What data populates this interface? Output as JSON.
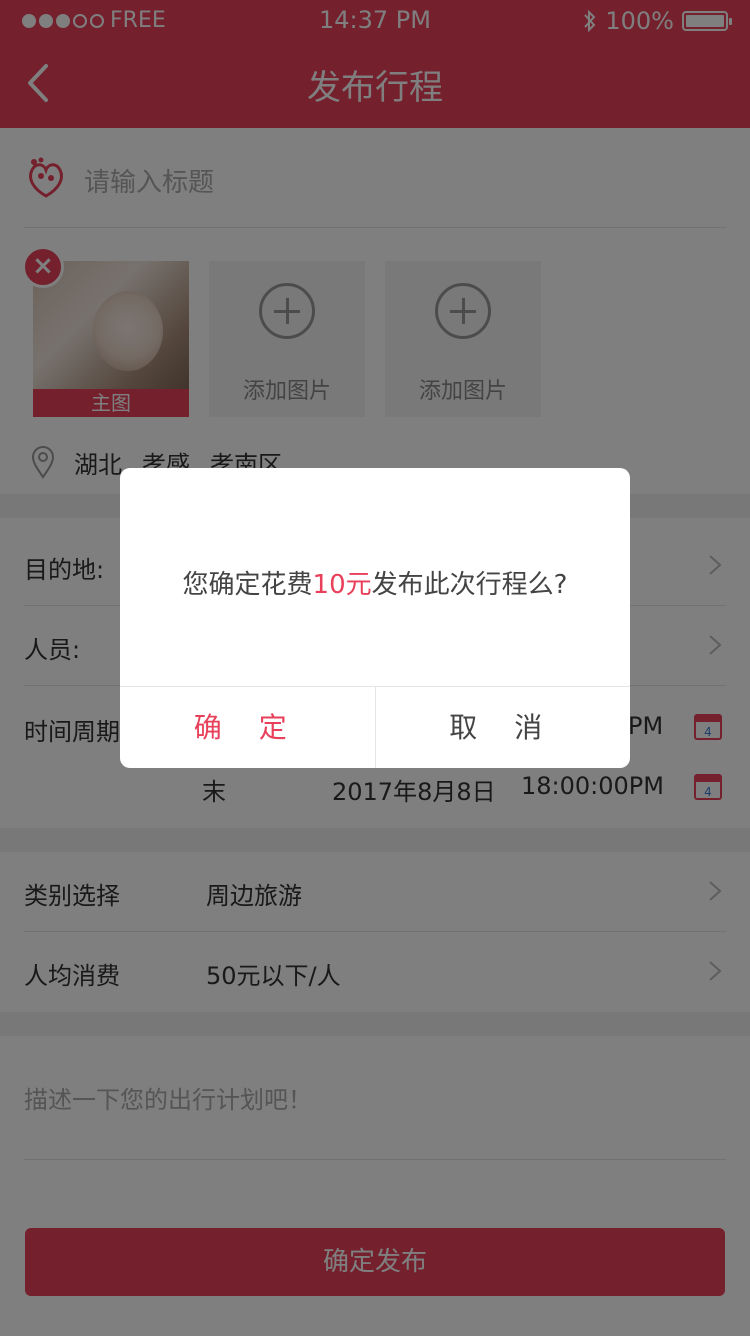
{
  "status_bar": {
    "carrier": "FREE",
    "time": "14:37 PM",
    "battery": "100%",
    "battery_level": 1.0,
    "signal_bars_filled": 3,
    "signal_bars_total": 5
  },
  "nav": {
    "title": "发布行程",
    "back_icon": "chevron-left-icon"
  },
  "form": {
    "title_placeholder": "请输入标题",
    "main_photo_label": "主图",
    "add_photo_label": "添加图片",
    "location": {
      "province": "湖北",
      "city": "孝感",
      "district": "孝南区"
    },
    "destination_label": "目的地:",
    "people_label": "人员:",
    "time_label": "时间周期",
    "time_start_suffix": "PM",
    "time_end_prefix": "末",
    "time_end_date": "2017年8月8日",
    "time_end_time": "18:00:00PM",
    "calendar_day": "4",
    "category_label": "类别选择",
    "category_value": "周边旅游",
    "spend_label": "人均消费",
    "spend_value": "50元以下/人",
    "description_placeholder": "描述一下您的出行计划吧！",
    "publish_button": "确定发布"
  },
  "dialog": {
    "message_prefix": "您确定花费",
    "message_amount": "10元",
    "message_suffix": "发布此次行程么?",
    "confirm_label": "确 定",
    "cancel_label": "取 消"
  },
  "colors": {
    "accent": "#e8405a",
    "overlay": "rgba(0,0,0,0.5)"
  }
}
